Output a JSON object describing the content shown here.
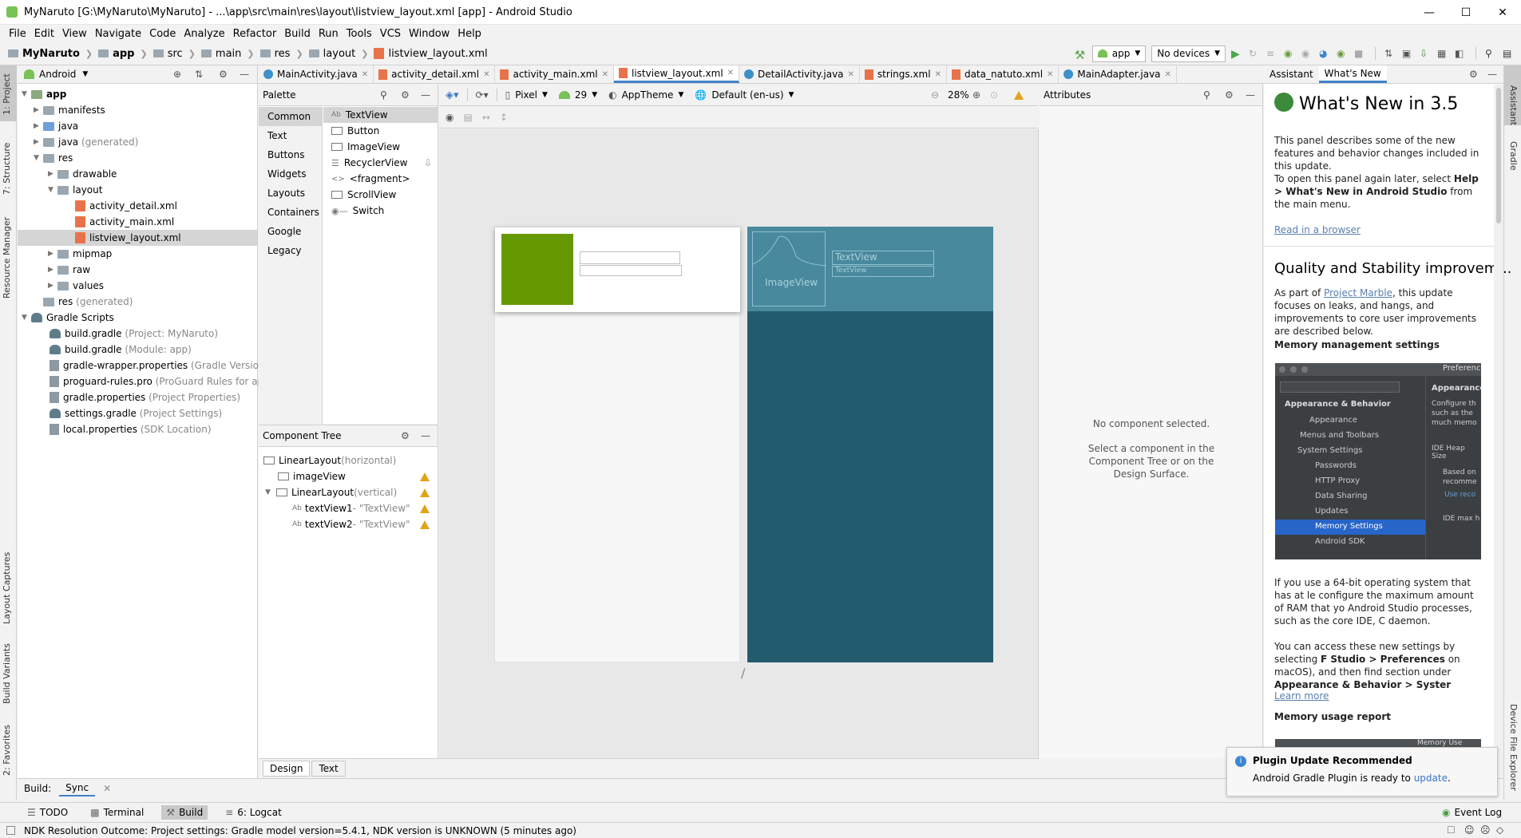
{
  "window": {
    "title": "MyNaruto [G:\\MyNaruto\\MyNaruto] - ...\\app\\src\\main\\res\\layout\\listview_layout.xml [app] - Android Studio"
  },
  "menu": [
    "File",
    "Edit",
    "View",
    "Navigate",
    "Code",
    "Analyze",
    "Refactor",
    "Build",
    "Run",
    "Tools",
    "VCS",
    "Window",
    "Help"
  ],
  "breadcrumb": [
    "MyNaruto",
    "app",
    "src",
    "main",
    "res",
    "layout",
    "listview_layout.xml"
  ],
  "toolbar": {
    "config": "app",
    "device": "No devices"
  },
  "left_strip": {
    "project": "1: Project",
    "structure": "7: Structure",
    "resource_manager": "Resource Manager",
    "layout_captures": "Layout Captures",
    "build_variants": "Build Variants",
    "favorites": "2: Favorites"
  },
  "right_strip": {
    "assistant": "Assistant",
    "gradle": "Gradle",
    "device_explorer": "Device File Explorer"
  },
  "project_panel": {
    "view_mode": "Android",
    "tree": [
      {
        "label": "app",
        "extra": ""
      },
      {
        "label": "manifests",
        "extra": ""
      },
      {
        "label": "java",
        "extra": ""
      },
      {
        "label": "java",
        "extra": "(generated)"
      },
      {
        "label": "res",
        "extra": ""
      },
      {
        "label": "drawable",
        "extra": ""
      },
      {
        "label": "layout",
        "extra": ""
      },
      {
        "label": "activity_detail.xml",
        "extra": ""
      },
      {
        "label": "activity_main.xml",
        "extra": ""
      },
      {
        "label": "listview_layout.xml",
        "extra": ""
      },
      {
        "label": "mipmap",
        "extra": ""
      },
      {
        "label": "raw",
        "extra": ""
      },
      {
        "label": "values",
        "extra": ""
      },
      {
        "label": "res",
        "extra": "(generated)"
      },
      {
        "label": "Gradle Scripts",
        "extra": ""
      },
      {
        "label": "build.gradle",
        "extra": "(Project: MyNaruto)"
      },
      {
        "label": "build.gradle",
        "extra": "(Module: app)"
      },
      {
        "label": "gradle-wrapper.properties",
        "extra": "(Gradle Version)"
      },
      {
        "label": "proguard-rules.pro",
        "extra": "(ProGuard Rules for app)"
      },
      {
        "label": "gradle.properties",
        "extra": "(Project Properties)"
      },
      {
        "label": "settings.gradle",
        "extra": "(Project Settings)"
      },
      {
        "label": "local.properties",
        "extra": "(SDK Location)"
      }
    ]
  },
  "editor_tabs": [
    "MainActivity.java",
    "activity_detail.xml",
    "activity_main.xml",
    "listview_layout.xml",
    "DetailActivity.java",
    "strings.xml",
    "data_natuto.xml",
    "MainAdapter.java"
  ],
  "palette": {
    "title": "Palette",
    "categories": [
      "Common",
      "Text",
      "Buttons",
      "Widgets",
      "Layouts",
      "Containers",
      "Google",
      "Legacy"
    ],
    "items": [
      "TextView",
      "Button",
      "ImageView",
      "RecyclerView",
      "<fragment>",
      "ScrollView",
      "Switch"
    ]
  },
  "design_toolbar": {
    "device": "Pixel",
    "api": "29",
    "theme": "AppTheme",
    "locale": "Default (en-us)",
    "zoom": "28%"
  },
  "component_tree": {
    "title": "Component Tree",
    "nodes": [
      {
        "name": "LinearLayout",
        "extra": "(horizontal)"
      },
      {
        "name": "imageView",
        "extra": ""
      },
      {
        "name": "LinearLayout",
        "extra": "(vertical)"
      },
      {
        "name": "textView1",
        "extra": "- \"TextView\""
      },
      {
        "name": "textView2",
        "extra": "- \"TextView\""
      }
    ]
  },
  "blueprint": {
    "image_label": "ImageView",
    "text1": "TextView",
    "text2": "TextView"
  },
  "attributes": {
    "title": "Attributes",
    "empty": "No component selected.",
    "hint": "Select a component in the Component Tree or on the Design Surface."
  },
  "assistant": {
    "tabs": [
      "Assistant",
      "What's New"
    ],
    "heading": "What's New in 3.5",
    "p1": "This panel describes some of the new features and behavior changes included in this update.",
    "p2a": "To open this panel again later, select ",
    "p2b": "Help > What's New in Android Studio",
    "p2c": " from the main menu.",
    "read_link": "Read in a browser",
    "h2": "Quality and Stability improvem...",
    "p3a": "As part of ",
    "p3link": "Project Marble",
    "p3b": ", this update focuses on leaks, and hangs, and improvements to core user improvements are described below.",
    "h3": "Memory management settings",
    "shot": {
      "title": "Preference",
      "tree": [
        "Appearance & Behavior",
        "Appearance",
        "Menus and Toolbars",
        "System Settings",
        "Passwords",
        "HTTP Proxy",
        "Data Sharing",
        "Updates",
        "Memory Settings",
        "Android SDK"
      ],
      "right_title": "Appearance",
      "right_lines": [
        "Configure th",
        "such as the",
        "much memo",
        "IDE Heap Size",
        "Based on",
        "recomme",
        "Use reco",
        "IDE max h"
      ]
    },
    "p4": "If you use a 64-bit operating system that has at le configure the maximum amount of RAM that yo Android Studio processes, such as the core IDE, C daemon.",
    "p5a": "You can access these new settings by selecting ",
    "p5b": "F Studio > Preferences",
    "p5c": " on macOS), and then find section under ",
    "p5d": "Appearance & Behavior > Syster",
    "learn_link": "Learn more",
    "h4": "Memory usage report",
    "shot2_title": "Memory Use Report"
  },
  "design_text_tabs": [
    "Design",
    "Text"
  ],
  "build_bar": {
    "label": "Build:",
    "tab": "Sync"
  },
  "tool_tabs": [
    "TODO",
    "Terminal",
    "Build",
    "6: Logcat"
  ],
  "event_log": "Event Log",
  "notification": {
    "title": "Plugin Update Recommended",
    "body": "Android Gradle Plugin is ready to ",
    "link": "update",
    "tail": "."
  },
  "status": "NDK Resolution Outcome: Project settings: Gradle model version=5.4.1, NDK version is UNKNOWN (5 minutes ago)",
  "colors": {
    "accent": "#4083c9",
    "blueprint_bg": "#235b6e",
    "image_green": "#669900",
    "warning": "#e2a21a",
    "memory_selected": "#2765c9"
  }
}
